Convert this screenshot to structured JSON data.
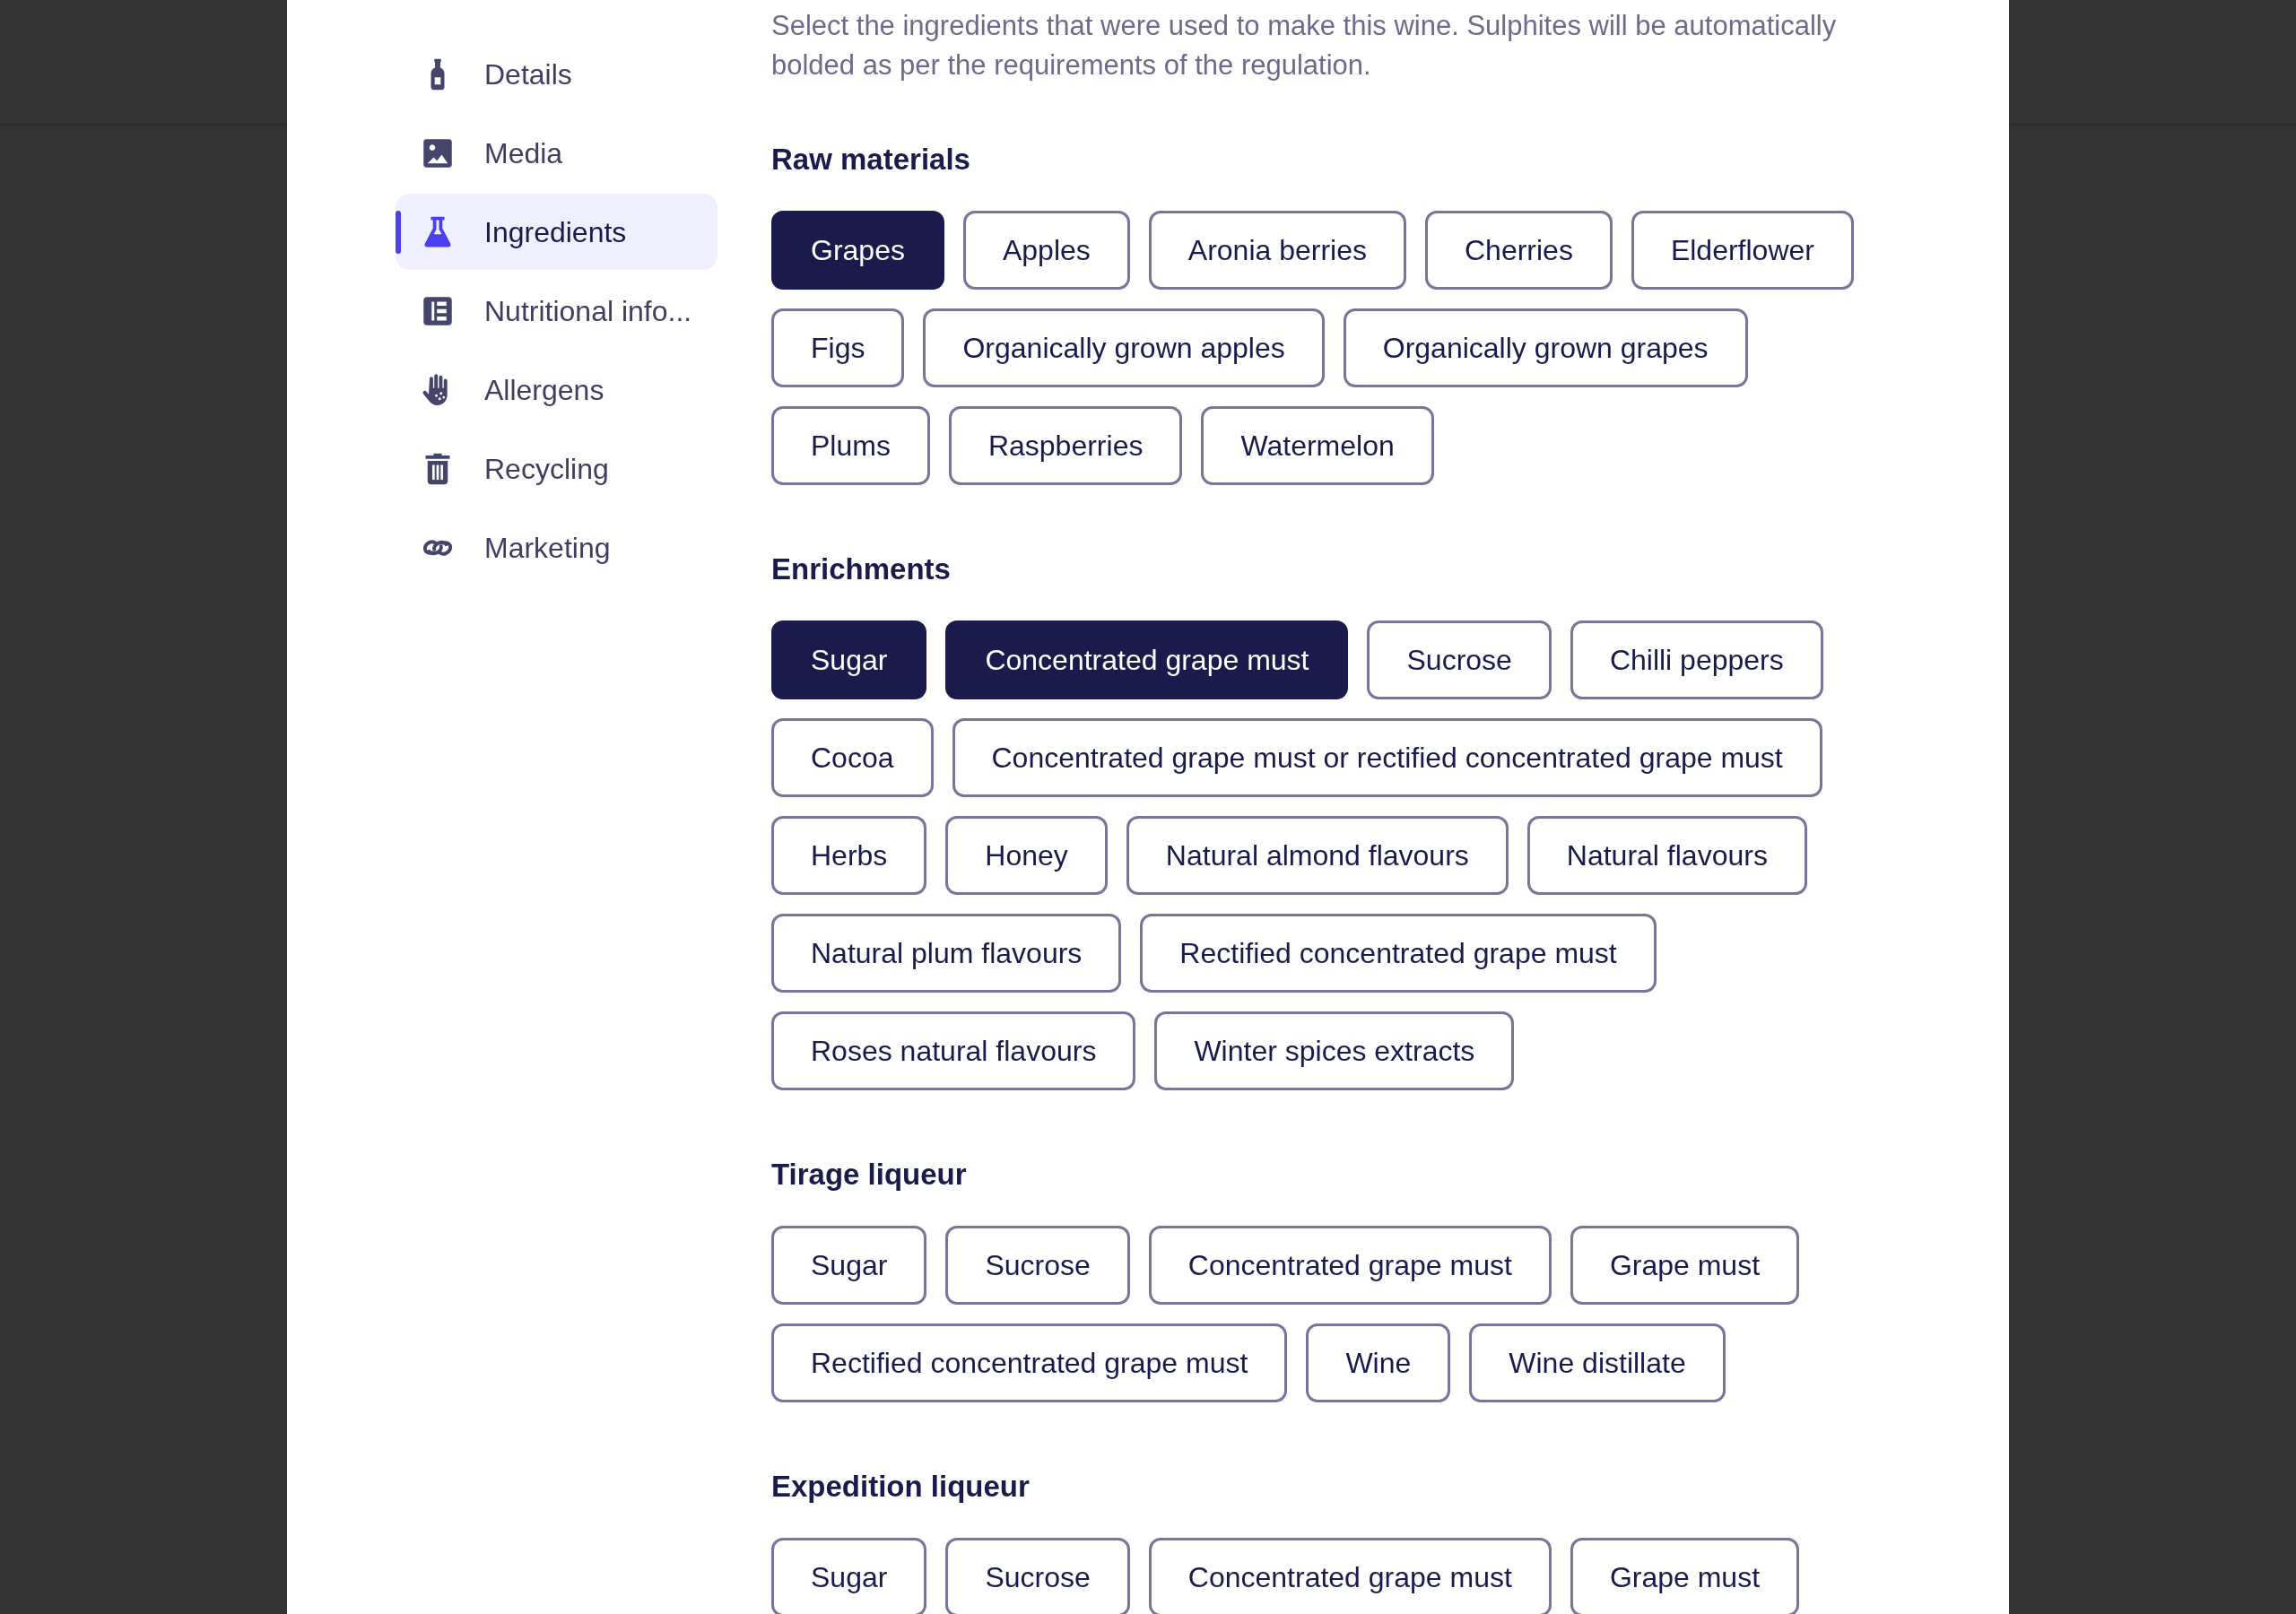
{
  "sidebar": {
    "items": [
      {
        "label": "Details",
        "selected": false
      },
      {
        "label": "Media",
        "selected": false
      },
      {
        "label": "Ingredients",
        "selected": true
      },
      {
        "label": "Nutritional info...",
        "selected": false
      },
      {
        "label": "Allergens",
        "selected": false
      },
      {
        "label": "Recycling",
        "selected": false
      },
      {
        "label": "Marketing",
        "selected": false
      }
    ]
  },
  "description": "Select the ingredients that were used to make this wine. Sulphites will be automatically bolded as per the requirements of the regulation.",
  "sections": [
    {
      "title": "Raw materials",
      "options": [
        {
          "label": "Grapes",
          "selected": true
        },
        {
          "label": "Apples",
          "selected": false
        },
        {
          "label": "Aronia berries",
          "selected": false
        },
        {
          "label": "Cherries",
          "selected": false
        },
        {
          "label": "Elderflower",
          "selected": false
        },
        {
          "label": "Figs",
          "selected": false
        },
        {
          "label": "Organically grown apples",
          "selected": false
        },
        {
          "label": "Organically grown grapes",
          "selected": false
        },
        {
          "label": "Plums",
          "selected": false
        },
        {
          "label": "Raspberries",
          "selected": false
        },
        {
          "label": "Watermelon",
          "selected": false
        }
      ]
    },
    {
      "title": "Enrichments",
      "options": [
        {
          "label": "Sugar",
          "selected": true
        },
        {
          "label": "Concentrated grape must",
          "selected": true
        },
        {
          "label": "Sucrose",
          "selected": false
        },
        {
          "label": "Chilli peppers",
          "selected": false
        },
        {
          "label": "Cocoa",
          "selected": false
        },
        {
          "label": "Concentrated grape must or rectified concentrated grape must",
          "selected": false
        },
        {
          "label": "Herbs",
          "selected": false
        },
        {
          "label": "Honey",
          "selected": false
        },
        {
          "label": "Natural almond flavours",
          "selected": false
        },
        {
          "label": "Natural flavours",
          "selected": false
        },
        {
          "label": "Natural plum flavours",
          "selected": false
        },
        {
          "label": "Rectified concentrated grape must",
          "selected": false
        },
        {
          "label": "Roses natural flavours",
          "selected": false
        },
        {
          "label": "Winter spices extracts",
          "selected": false
        }
      ]
    },
    {
      "title": "Tirage liqueur",
      "options": [
        {
          "label": "Sugar",
          "selected": false
        },
        {
          "label": "Sucrose",
          "selected": false
        },
        {
          "label": "Concentrated grape must",
          "selected": false
        },
        {
          "label": "Grape must",
          "selected": false
        },
        {
          "label": "Rectified concentrated grape must",
          "selected": false
        },
        {
          "label": "Wine",
          "selected": false
        },
        {
          "label": "Wine distillate",
          "selected": false
        }
      ]
    },
    {
      "title": "Expedition liqueur",
      "options": [
        {
          "label": "Sugar",
          "selected": false
        },
        {
          "label": "Sucrose",
          "selected": false
        },
        {
          "label": "Concentrated grape must",
          "selected": false
        },
        {
          "label": "Grape must",
          "selected": false
        }
      ]
    }
  ]
}
